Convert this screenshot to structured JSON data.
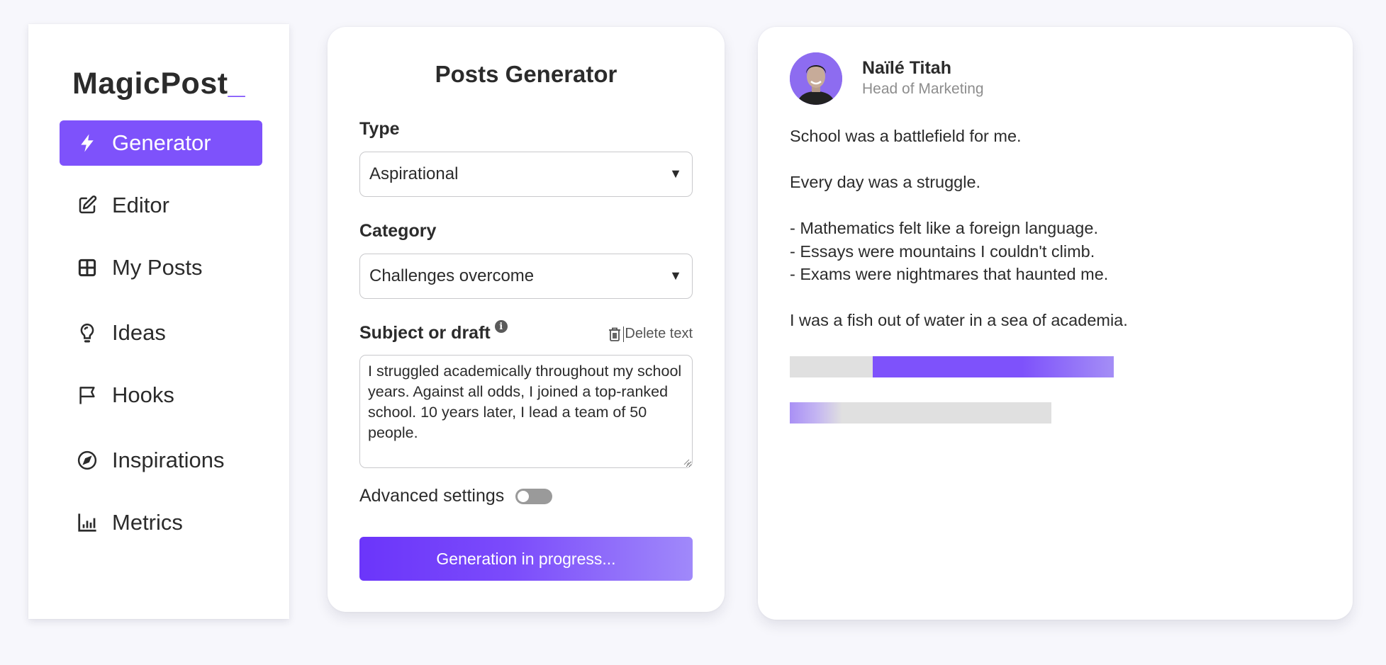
{
  "app": {
    "logo_text": "MagicPost",
    "logo_cursor": "_",
    "accent_color": "#7e52fb"
  },
  "sidebar": {
    "items": [
      {
        "label": "Generator",
        "icon": "bolt-icon",
        "active": true
      },
      {
        "label": "Editor",
        "icon": "edit-icon",
        "active": false
      },
      {
        "label": "My Posts",
        "icon": "grid-icon",
        "active": false
      },
      {
        "label": "Ideas",
        "icon": "lightbulb-icon",
        "active": false
      },
      {
        "label": "Hooks",
        "icon": "flag-icon",
        "active": false
      },
      {
        "label": "Inspirations",
        "icon": "compass-icon",
        "active": false
      },
      {
        "label": "Metrics",
        "icon": "bar-chart-icon",
        "active": false
      }
    ]
  },
  "generator": {
    "title": "Posts Generator",
    "type_label": "Type",
    "type_value": "Aspirational",
    "category_label": "Category",
    "category_value": "Challenges overcome",
    "subject_label": "Subject or draft",
    "info_glyph": "i",
    "delete_label": "Delete text",
    "subject_value": "I struggled academically throughout my school years. Against all odds, I joined a top-ranked school. 10 years later, I lead a team of 50 people.",
    "advanced_label": "Advanced settings",
    "advanced_enabled": false,
    "generate_button_label": "Generation in progress..."
  },
  "preview": {
    "author_name": "Naïlé Titah",
    "author_role": "Head of Marketing",
    "lines": [
      "School was a battlefield for me.",
      "",
      "Every day was a struggle.",
      "",
      "- Mathematics felt like a foreign language.",
      "- Essays were mountains I couldn't climb.",
      "- Exams were nightmares that haunted me.",
      "",
      "I was a fish out of water in a sea of academia."
    ],
    "loading_bars": [
      {
        "fill_start": 0.255,
        "fill_end": 1.0
      },
      {
        "fill_start": 0.0,
        "fill_end": 0.2
      }
    ]
  }
}
